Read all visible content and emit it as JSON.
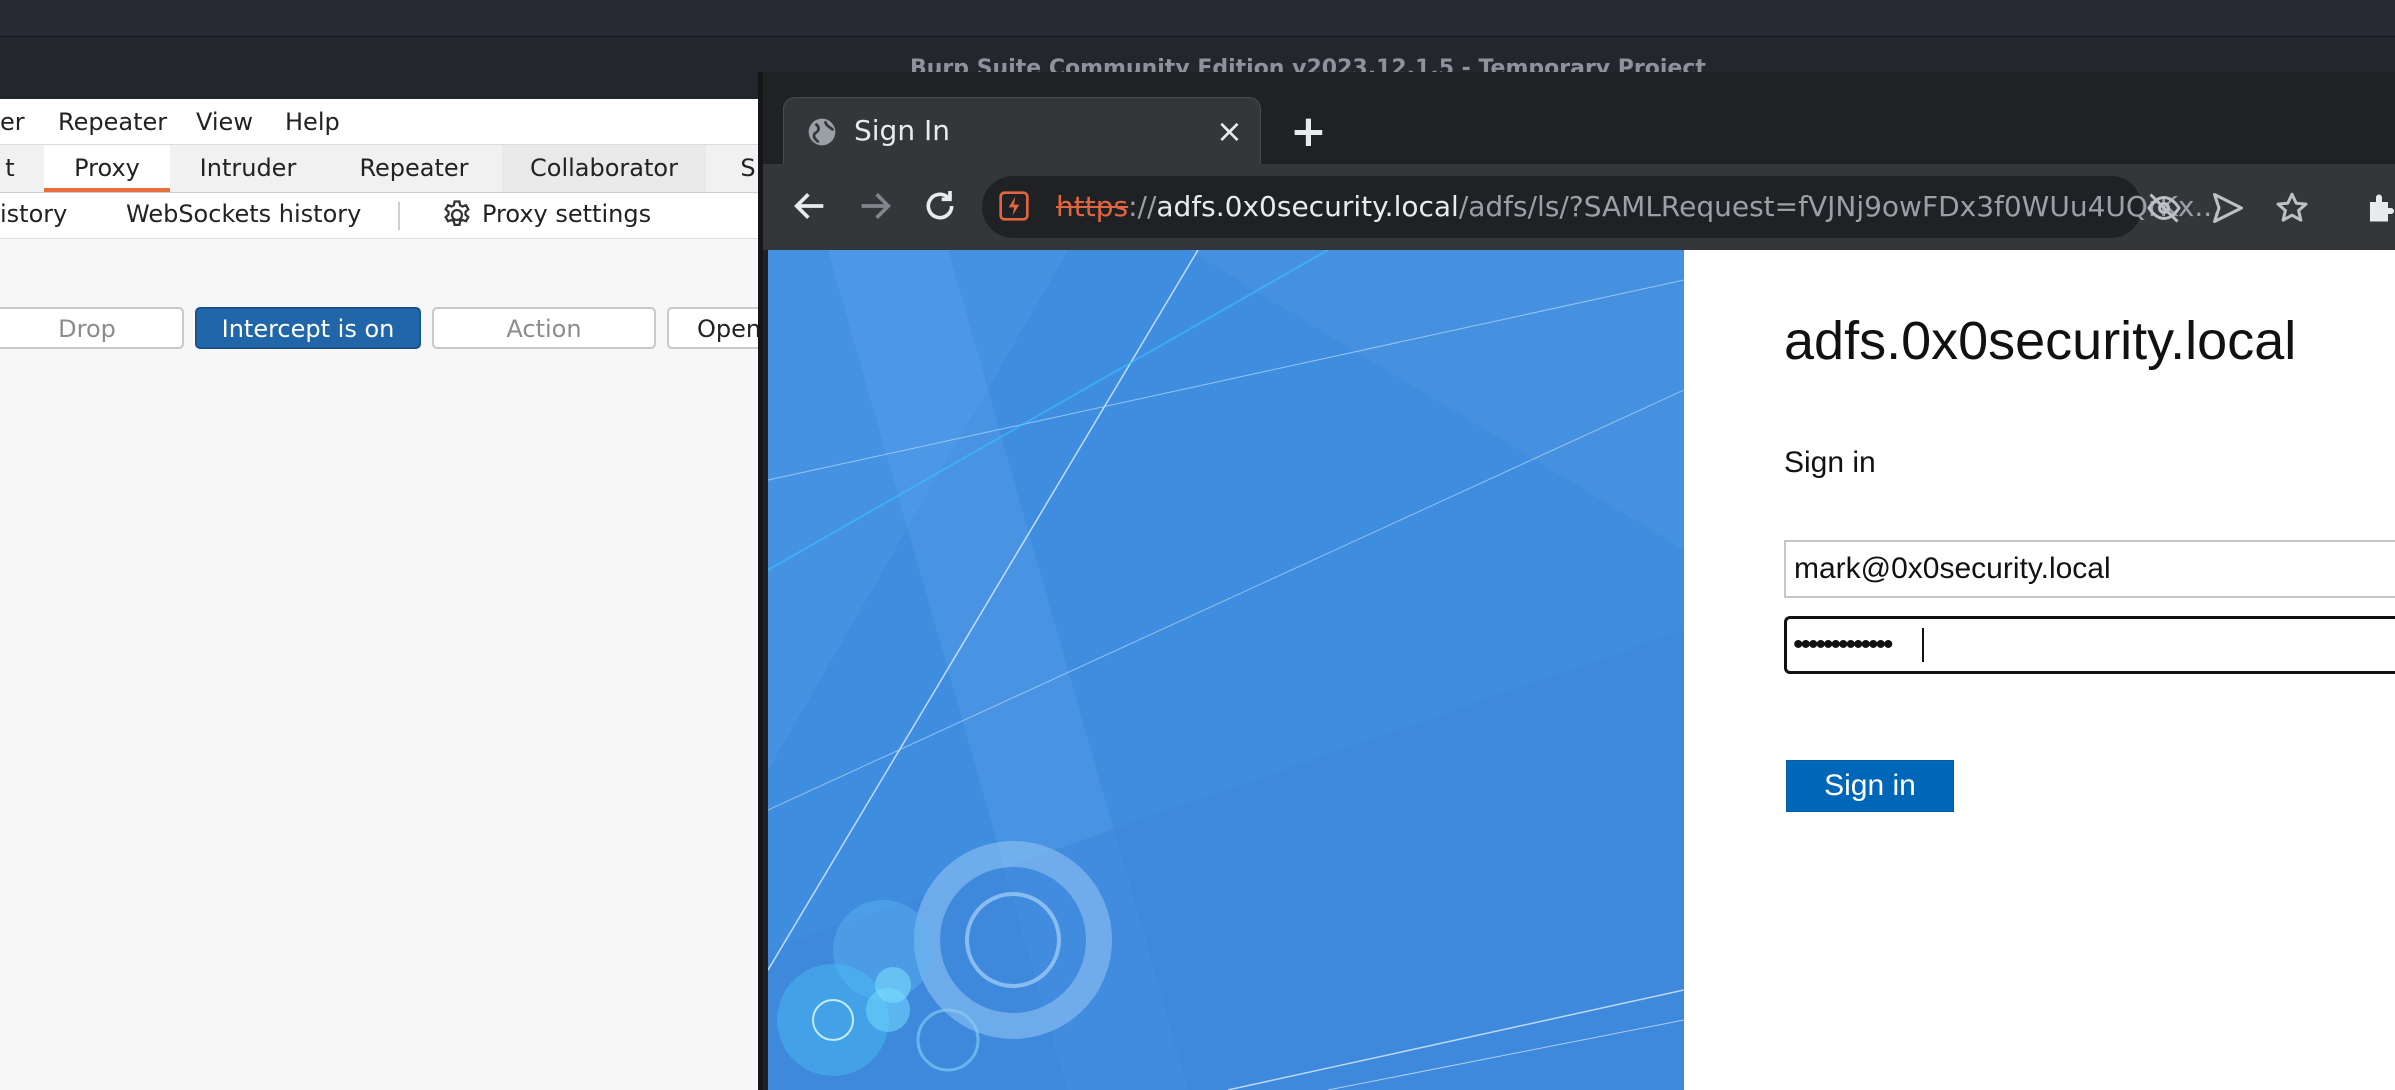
{
  "os": {
    "window_title": "Burp Suite Community Edition v2023.12.1.5 - Temporary Project"
  },
  "burp": {
    "menu": [
      "er",
      "Repeater",
      "View",
      "Help"
    ],
    "tabs": [
      "t",
      "Proxy",
      "Intruder",
      "Repeater",
      "Collaborator",
      "S"
    ],
    "active_tab": "Proxy",
    "subtabs": [
      "istory",
      "WebSockets history"
    ],
    "proxy_settings_label": "Proxy settings",
    "buttons": {
      "drop": "Drop",
      "intercept": "Intercept is on",
      "action": "Action",
      "open": "Open"
    }
  },
  "browser": {
    "tab_title": "Sign In",
    "new_tab": "+",
    "close": "×",
    "url_scheme": "https",
    "url_sep": "://",
    "url_host": "adfs.0x0security.local",
    "url_path": "/adfs/ls/?SAMLRequest=fVJNj9owFDx3f0WUu4UQrKx..."
  },
  "page": {
    "site_title": "adfs.0x0security.local",
    "heading": "Sign in",
    "username_value": "mark@0x0security.local",
    "password_mask": "•••••••••••••",
    "signin_button": "Sign in"
  },
  "colors": {
    "burp_accent": "#e8703a",
    "intercept_blue": "#2166a8",
    "adfs_blue": "#0067b8",
    "illustration_blue": "#3f8ddf"
  }
}
